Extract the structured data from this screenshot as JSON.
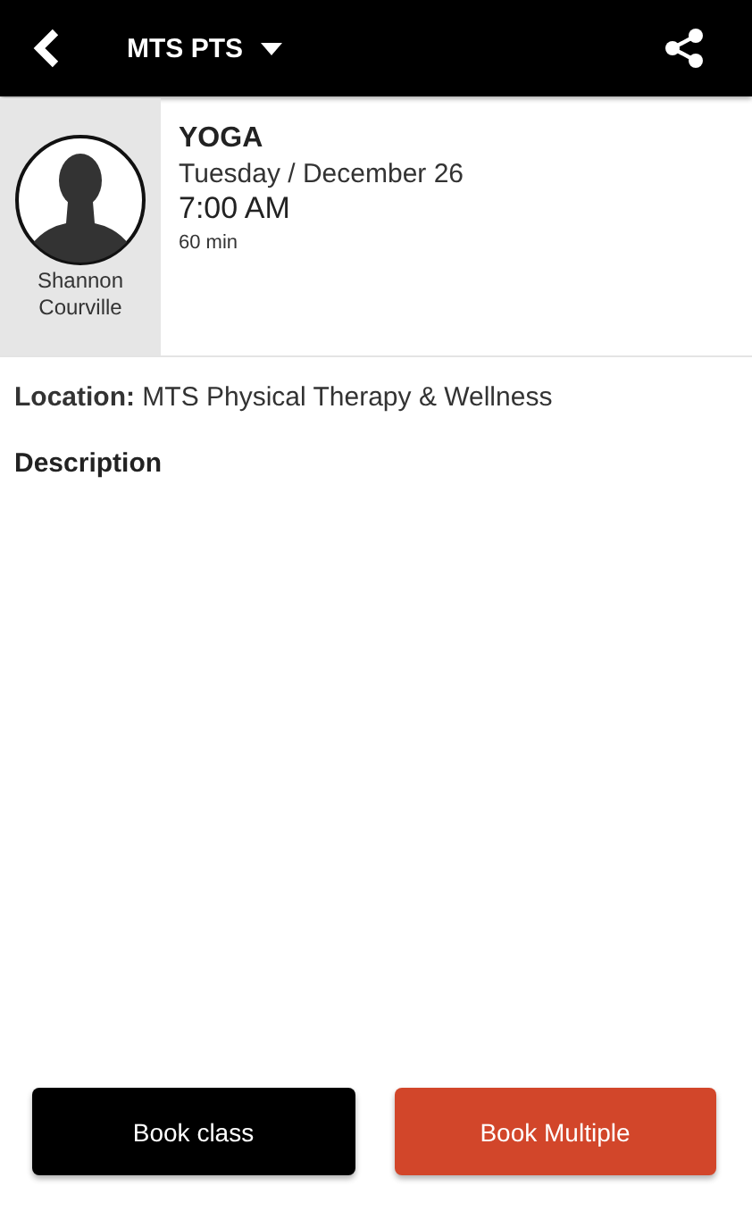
{
  "header": {
    "title": "MTS PTS"
  },
  "instructor": {
    "name": "Shannon Courville"
  },
  "session": {
    "title": "YOGA",
    "date": "Tuesday / December 26",
    "time": "7:00 AM",
    "duration": "60 min"
  },
  "location": "**Location:** MTS Physical Therapy & Wellness",
  "description_heading": "Description",
  "buttons": [
    {
      "label": "Book class",
      "color": "#000000"
    },
    {
      "label": "Book Multiple",
      "color": "#d2462a"
    }
  ]
}
